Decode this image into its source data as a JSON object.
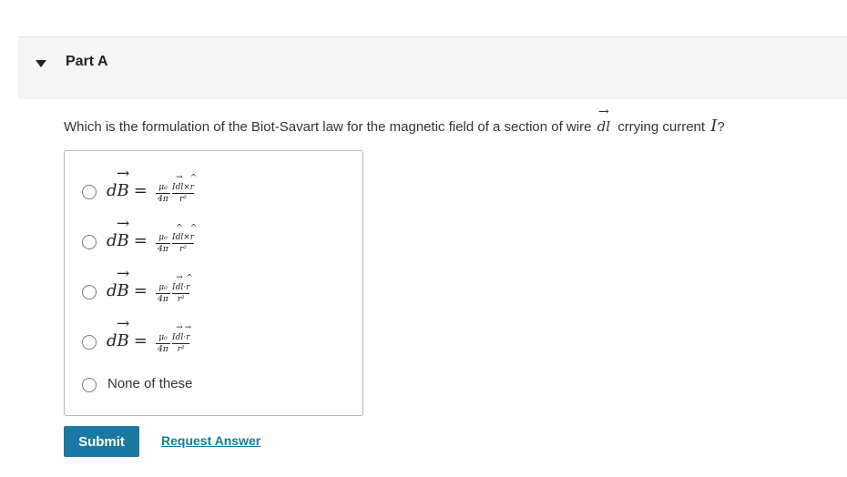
{
  "part": {
    "title": "Part A"
  },
  "question": {
    "text_before": "Which is the formulation of the Biot-Savart law for the magnetic field of a section of wire",
    "dl_symbol": "dl",
    "text_after": "crrying current",
    "current_symbol": "I",
    "end": "?"
  },
  "formula": {
    "lhs_d": "d",
    "lhs_B": "B",
    "equals": "=",
    "mu0": "μ₀",
    "four_pi": "4π",
    "r_squared": "r²"
  },
  "options": [
    {
      "id": "a",
      "numerator": [
        "I",
        "dl",
        "×",
        "r"
      ]
    },
    {
      "id": "b",
      "numerator": [
        "I",
        "dl",
        "×",
        "r"
      ]
    },
    {
      "id": "c",
      "numerator": [
        "I",
        "dl",
        "·",
        "r"
      ]
    },
    {
      "id": "d",
      "numerator": [
        "I",
        "dl",
        "·",
        "r"
      ]
    }
  ],
  "option_none_label": "None of these",
  "actions": {
    "submit_label": "Submit",
    "request_answer_label": "Request Answer"
  },
  "colors": {
    "accent": "#1a78a3",
    "header_bg": "#f5f5f5",
    "box_border": "#b9b9b9"
  }
}
